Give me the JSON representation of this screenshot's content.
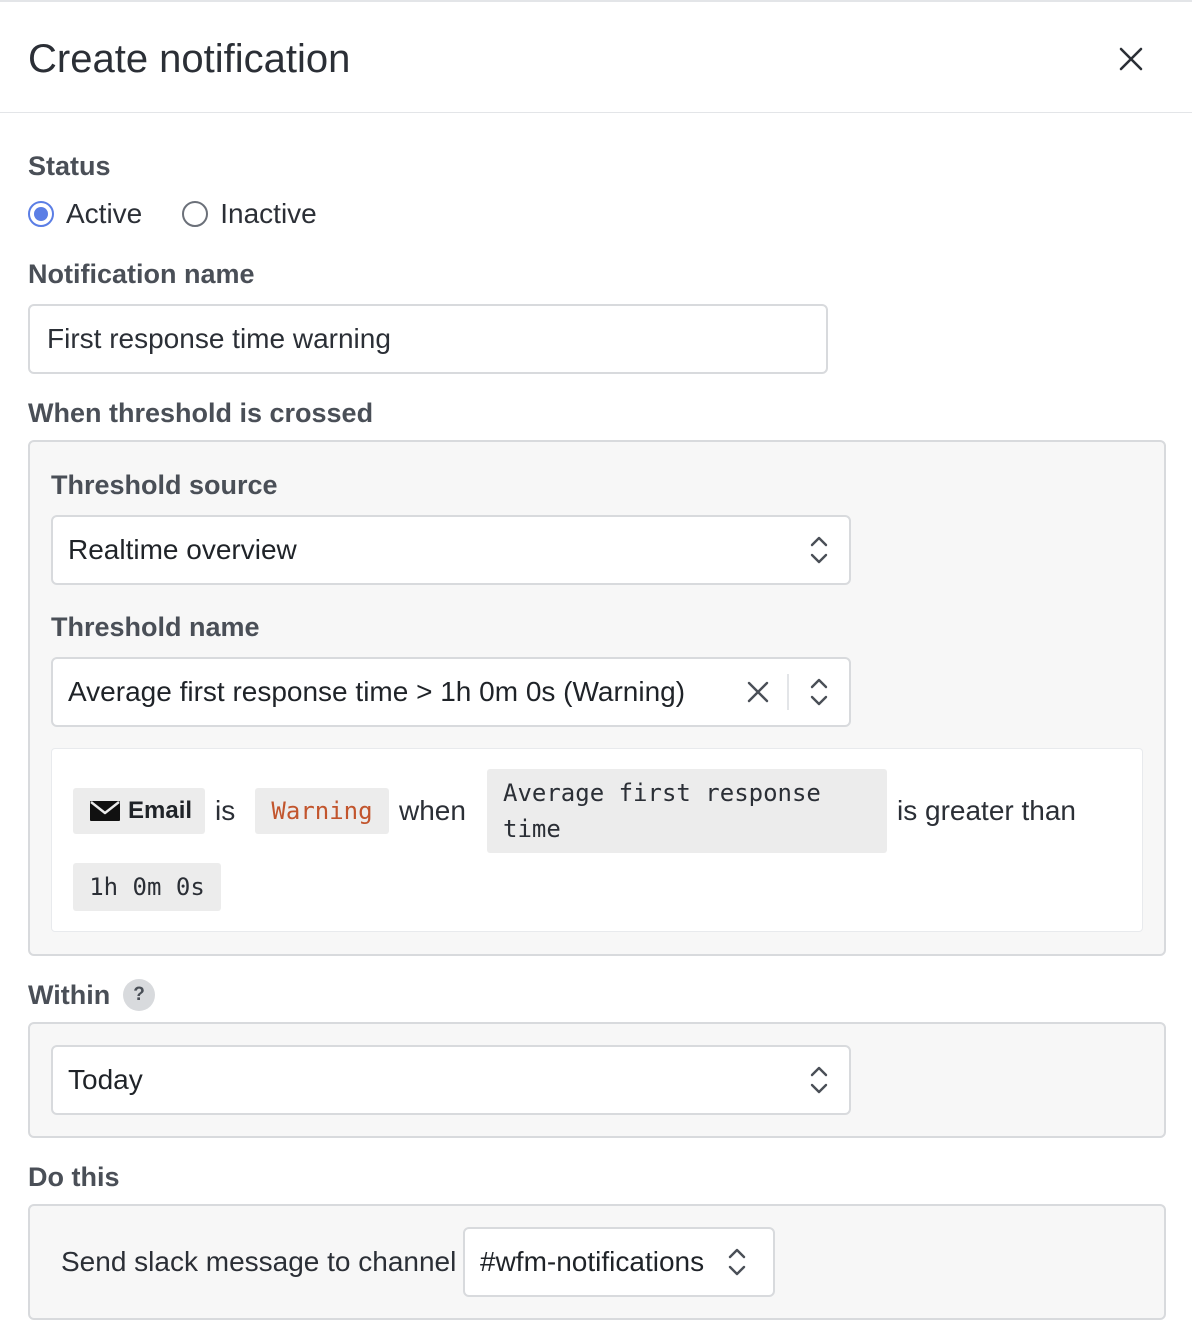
{
  "dialog": {
    "title": "Create notification"
  },
  "status": {
    "label": "Status",
    "options": [
      {
        "label": "Active",
        "selected": true
      },
      {
        "label": "Inactive",
        "selected": false
      }
    ]
  },
  "name_field": {
    "label": "Notification name",
    "value": "First response time warning"
  },
  "threshold": {
    "section_label": "When threshold is crossed",
    "source_label": "Threshold source",
    "source_value": "Realtime overview",
    "name_label": "Threshold name",
    "name_value": "Average first response time > 1h 0m 0s (Warning)",
    "rule": {
      "channel": "Email",
      "word_is": "is",
      "level": "Warning",
      "word_when": "when",
      "metric_line1": "Average first response",
      "metric_line2": "time",
      "comparison": "is greater than",
      "value": "1h 0m 0s"
    }
  },
  "within": {
    "label": "Within",
    "help_glyph": "?",
    "value": "Today"
  },
  "action": {
    "label": "Do this",
    "prefix": "Send slack message to channel",
    "channel": "#wfm-notifications"
  },
  "colors": {
    "accent": "#5b7ee5",
    "warning_text": "#c2552d",
    "panel_bg": "#f7f7f7"
  },
  "icons": [
    "close-icon",
    "chevron-updown-icon",
    "clear-icon",
    "envelope-icon",
    "help-icon"
  ]
}
